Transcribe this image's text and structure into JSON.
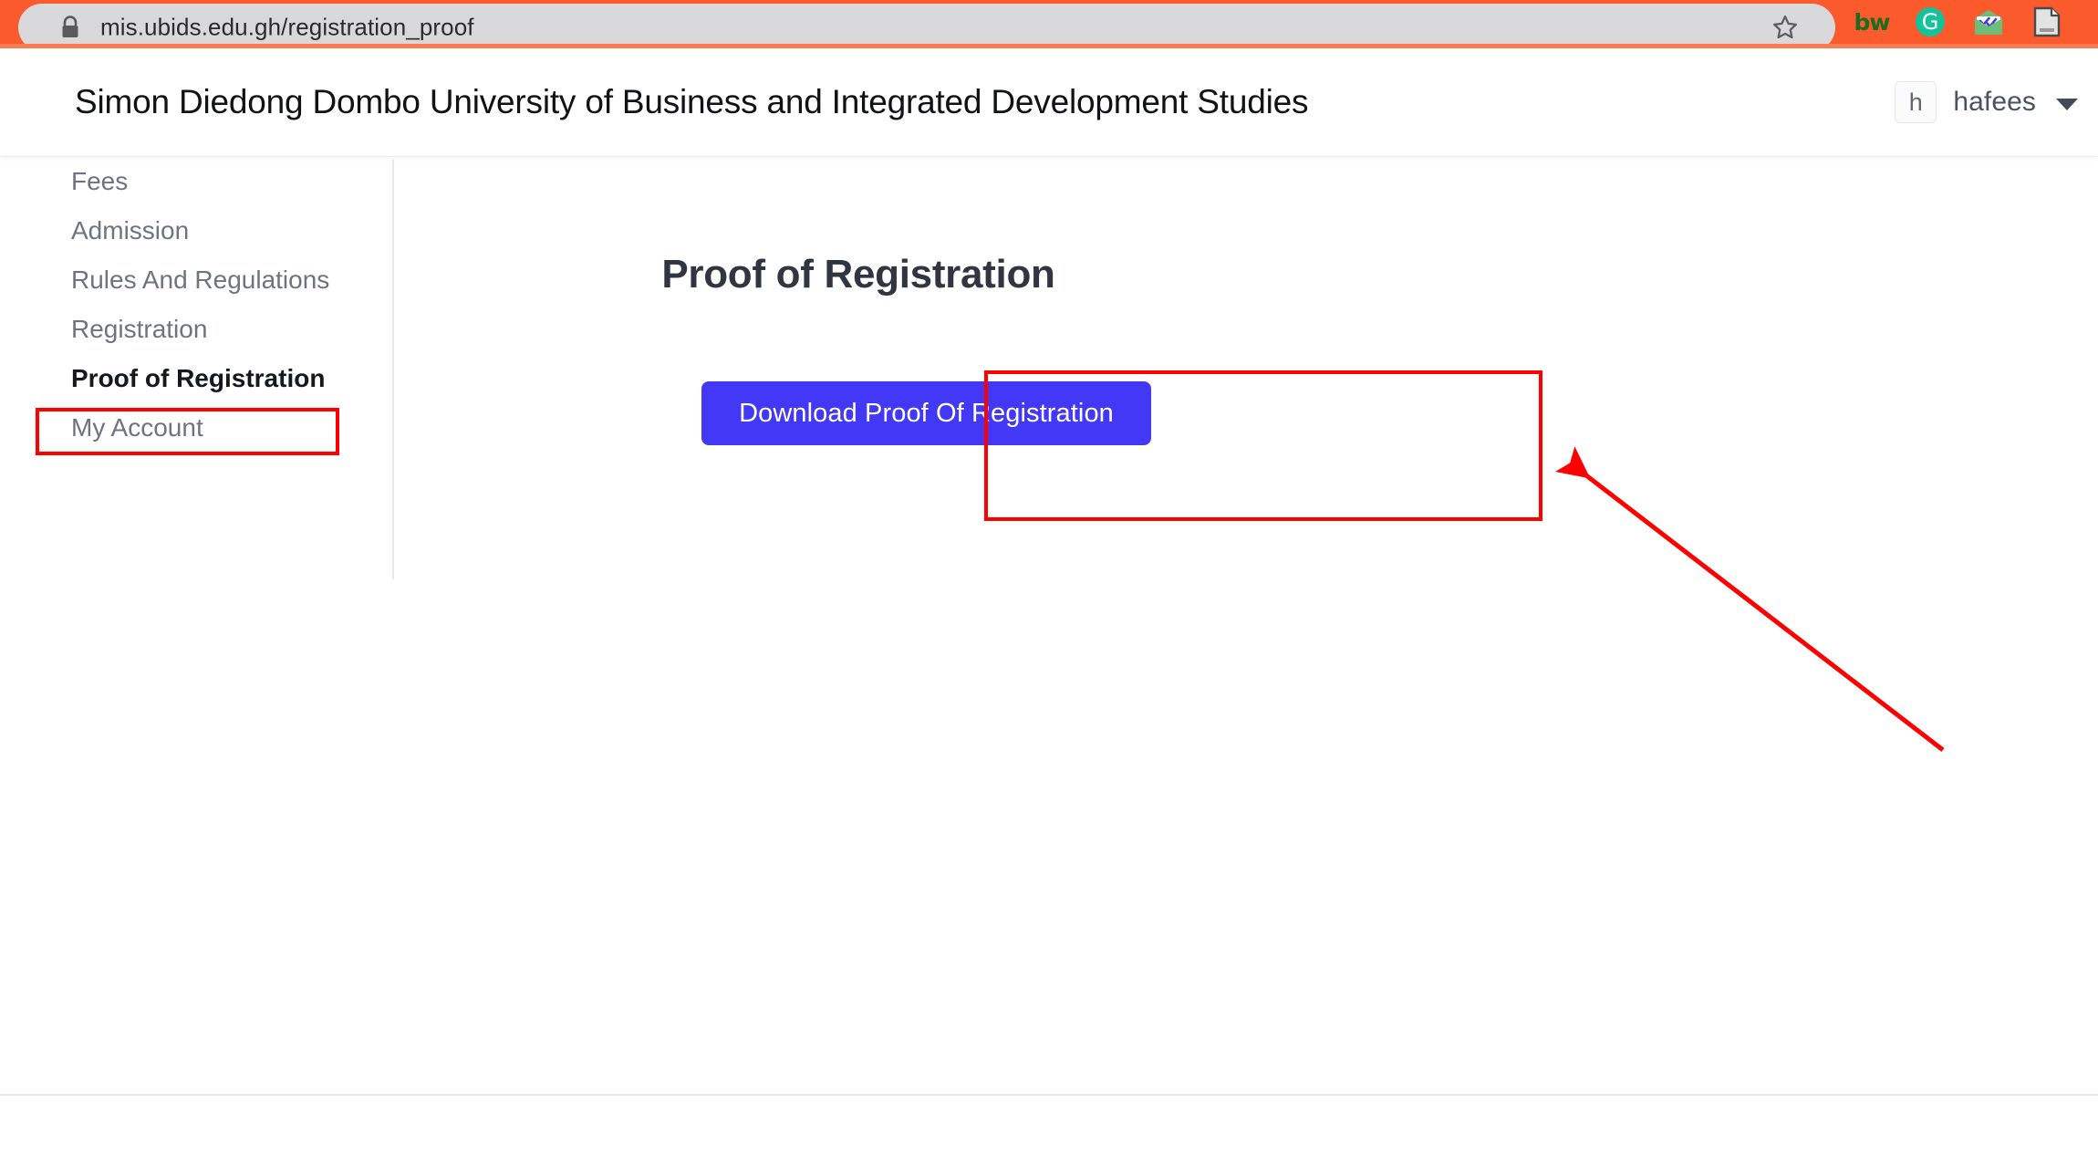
{
  "browser": {
    "url": "mis.ubids.edu.gh/registration_proof",
    "lock_icon": "lock-icon",
    "bookmark_icon": "star-icon",
    "theme_color": "#fb5a2c",
    "extensions": [
      {
        "name": "bitwarden-extension-icon",
        "label": "bw"
      },
      {
        "name": "grammarly-extension-icon",
        "label": "G"
      },
      {
        "name": "mail-extension-icon",
        "label": ""
      },
      {
        "name": "document-extension-icon",
        "label": ""
      }
    ]
  },
  "header": {
    "title": "Simon Diedong Dombo University of Business and Integrated Development Studies",
    "user": {
      "avatar_initial": "h",
      "name": "hafees",
      "caret_icon": "chevron-down-icon"
    }
  },
  "sidebar": {
    "items": [
      {
        "label": "Fees",
        "active": false
      },
      {
        "label": "Admission",
        "active": false
      },
      {
        "label": "Rules And Regulations",
        "active": false
      },
      {
        "label": "Registration",
        "active": false
      },
      {
        "label": "Proof of Registration",
        "active": true
      },
      {
        "label": "My Account",
        "active": false
      }
    ]
  },
  "main": {
    "page_title": "Proof of Registration",
    "download_button_label": "Download Proof Of Registration",
    "button_color": "#4338f5"
  },
  "annotations": {
    "color": "#fe0000",
    "highlight_sidebar_item": "Proof of Registration",
    "highlight_button": "Download Proof Of Registration",
    "arrow": "points from lower-right toward the Download Proof Of Registration button"
  }
}
